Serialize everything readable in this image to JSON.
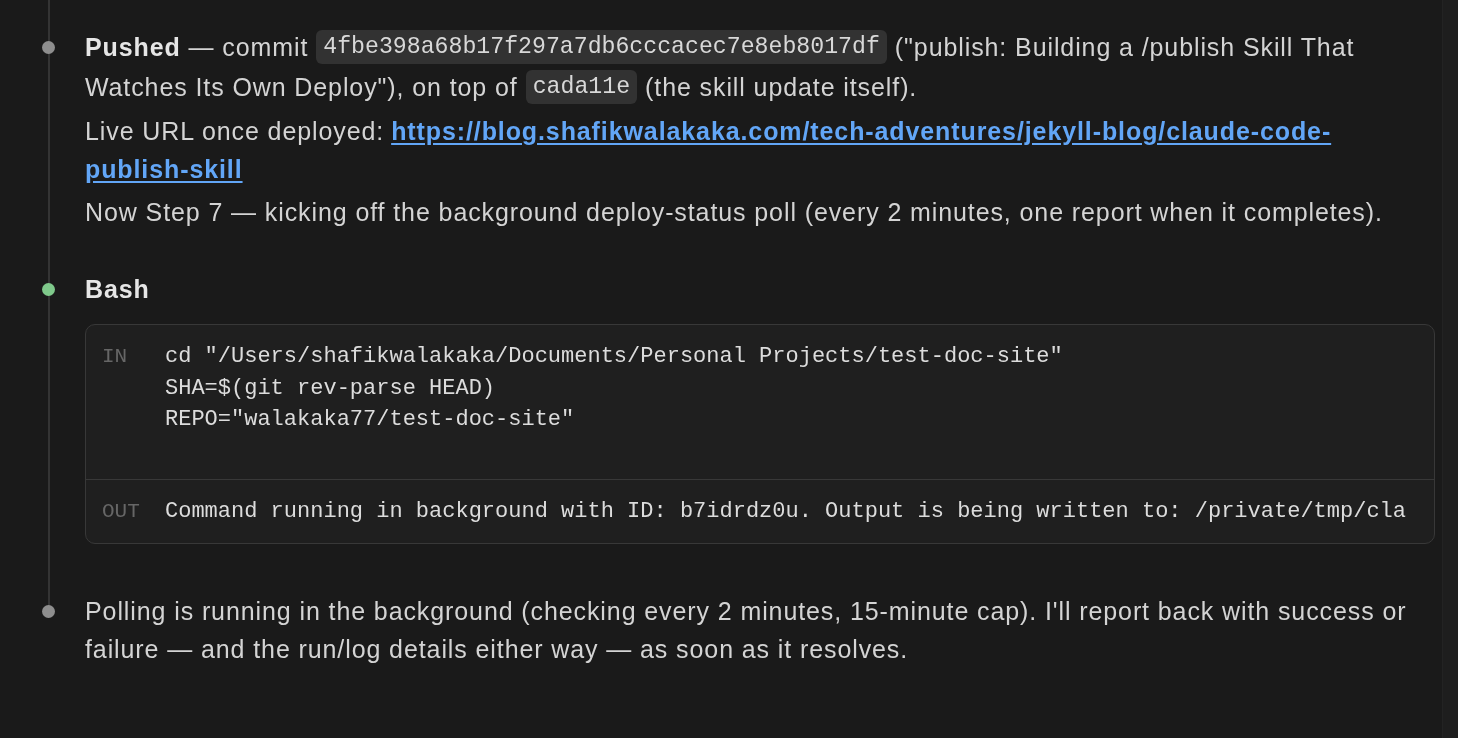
{
  "entries": [
    {
      "kind": "message",
      "color": "#8e8e8e",
      "paragraphs": [
        {
          "lines": [
            [
              {
                "kind": "text",
                "text": "**Pushed** — commit"
              },
              {
                "kind": "code",
                "text": "4fbe398a68b17f297a7db6cccacec7e8eb8017df"
              },
              {
                "kind": "text",
                "text": "(\"publish: Building a /publish Skill That"
              }
            ],
            [
              {
                "kind": "text",
                "text": "Watches Its Own Deploy\"), on top of"
              },
              {
                "kind": "code",
                "text": "cada11e"
              },
              {
                "kind": "text",
                "text": "(the skill update itself)."
              }
            ]
          ]
        },
        {
          "lines": [
            [
              {
                "kind": "text",
                "text": "Live URL once deployed:"
              },
              {
                "kind": "link",
                "text": "https://blog.shafikwalakaka.com/tech-adventures/jekyll-blog/claude-code-"
              }
            ],
            [
              {
                "kind": "link",
                "text": "publish-skill"
              }
            ]
          ]
        },
        {
          "lines": [
            [
              {
                "kind": "text",
                "text": "Now Step 7 — kicking off the background deploy-status poll (every 2 minutes, one report when it completes)."
              }
            ]
          ]
        }
      ]
    },
    {
      "kind": "tool",
      "color": "#7fc98b",
      "title": "Bash",
      "input": {
        "label": "IN",
        "lines": [
          "cd \"/Users/shafikwalakaka/Documents/Personal Projects/test-doc-site\"",
          "SHA=$(git rev-parse HEAD)",
          "REPO=\"walakaka77/test-doc-site\""
        ]
      },
      "output": {
        "label": "OUT",
        "text": "Command running in background with ID: b7idrdz0u. Output is being written to: /private/tmp/cla"
      }
    },
    {
      "kind": "message",
      "color": "#8e8e8e",
      "paragraphs": [
        {
          "lines": [
            [
              {
                "kind": "text",
                "text": "Polling is running in the background (checking every 2 minutes, 15-minute cap). I'll report back with success or failure — and the run/log details either way — as soon as it resolves."
              }
            ]
          ]
        }
      ]
    }
  ]
}
